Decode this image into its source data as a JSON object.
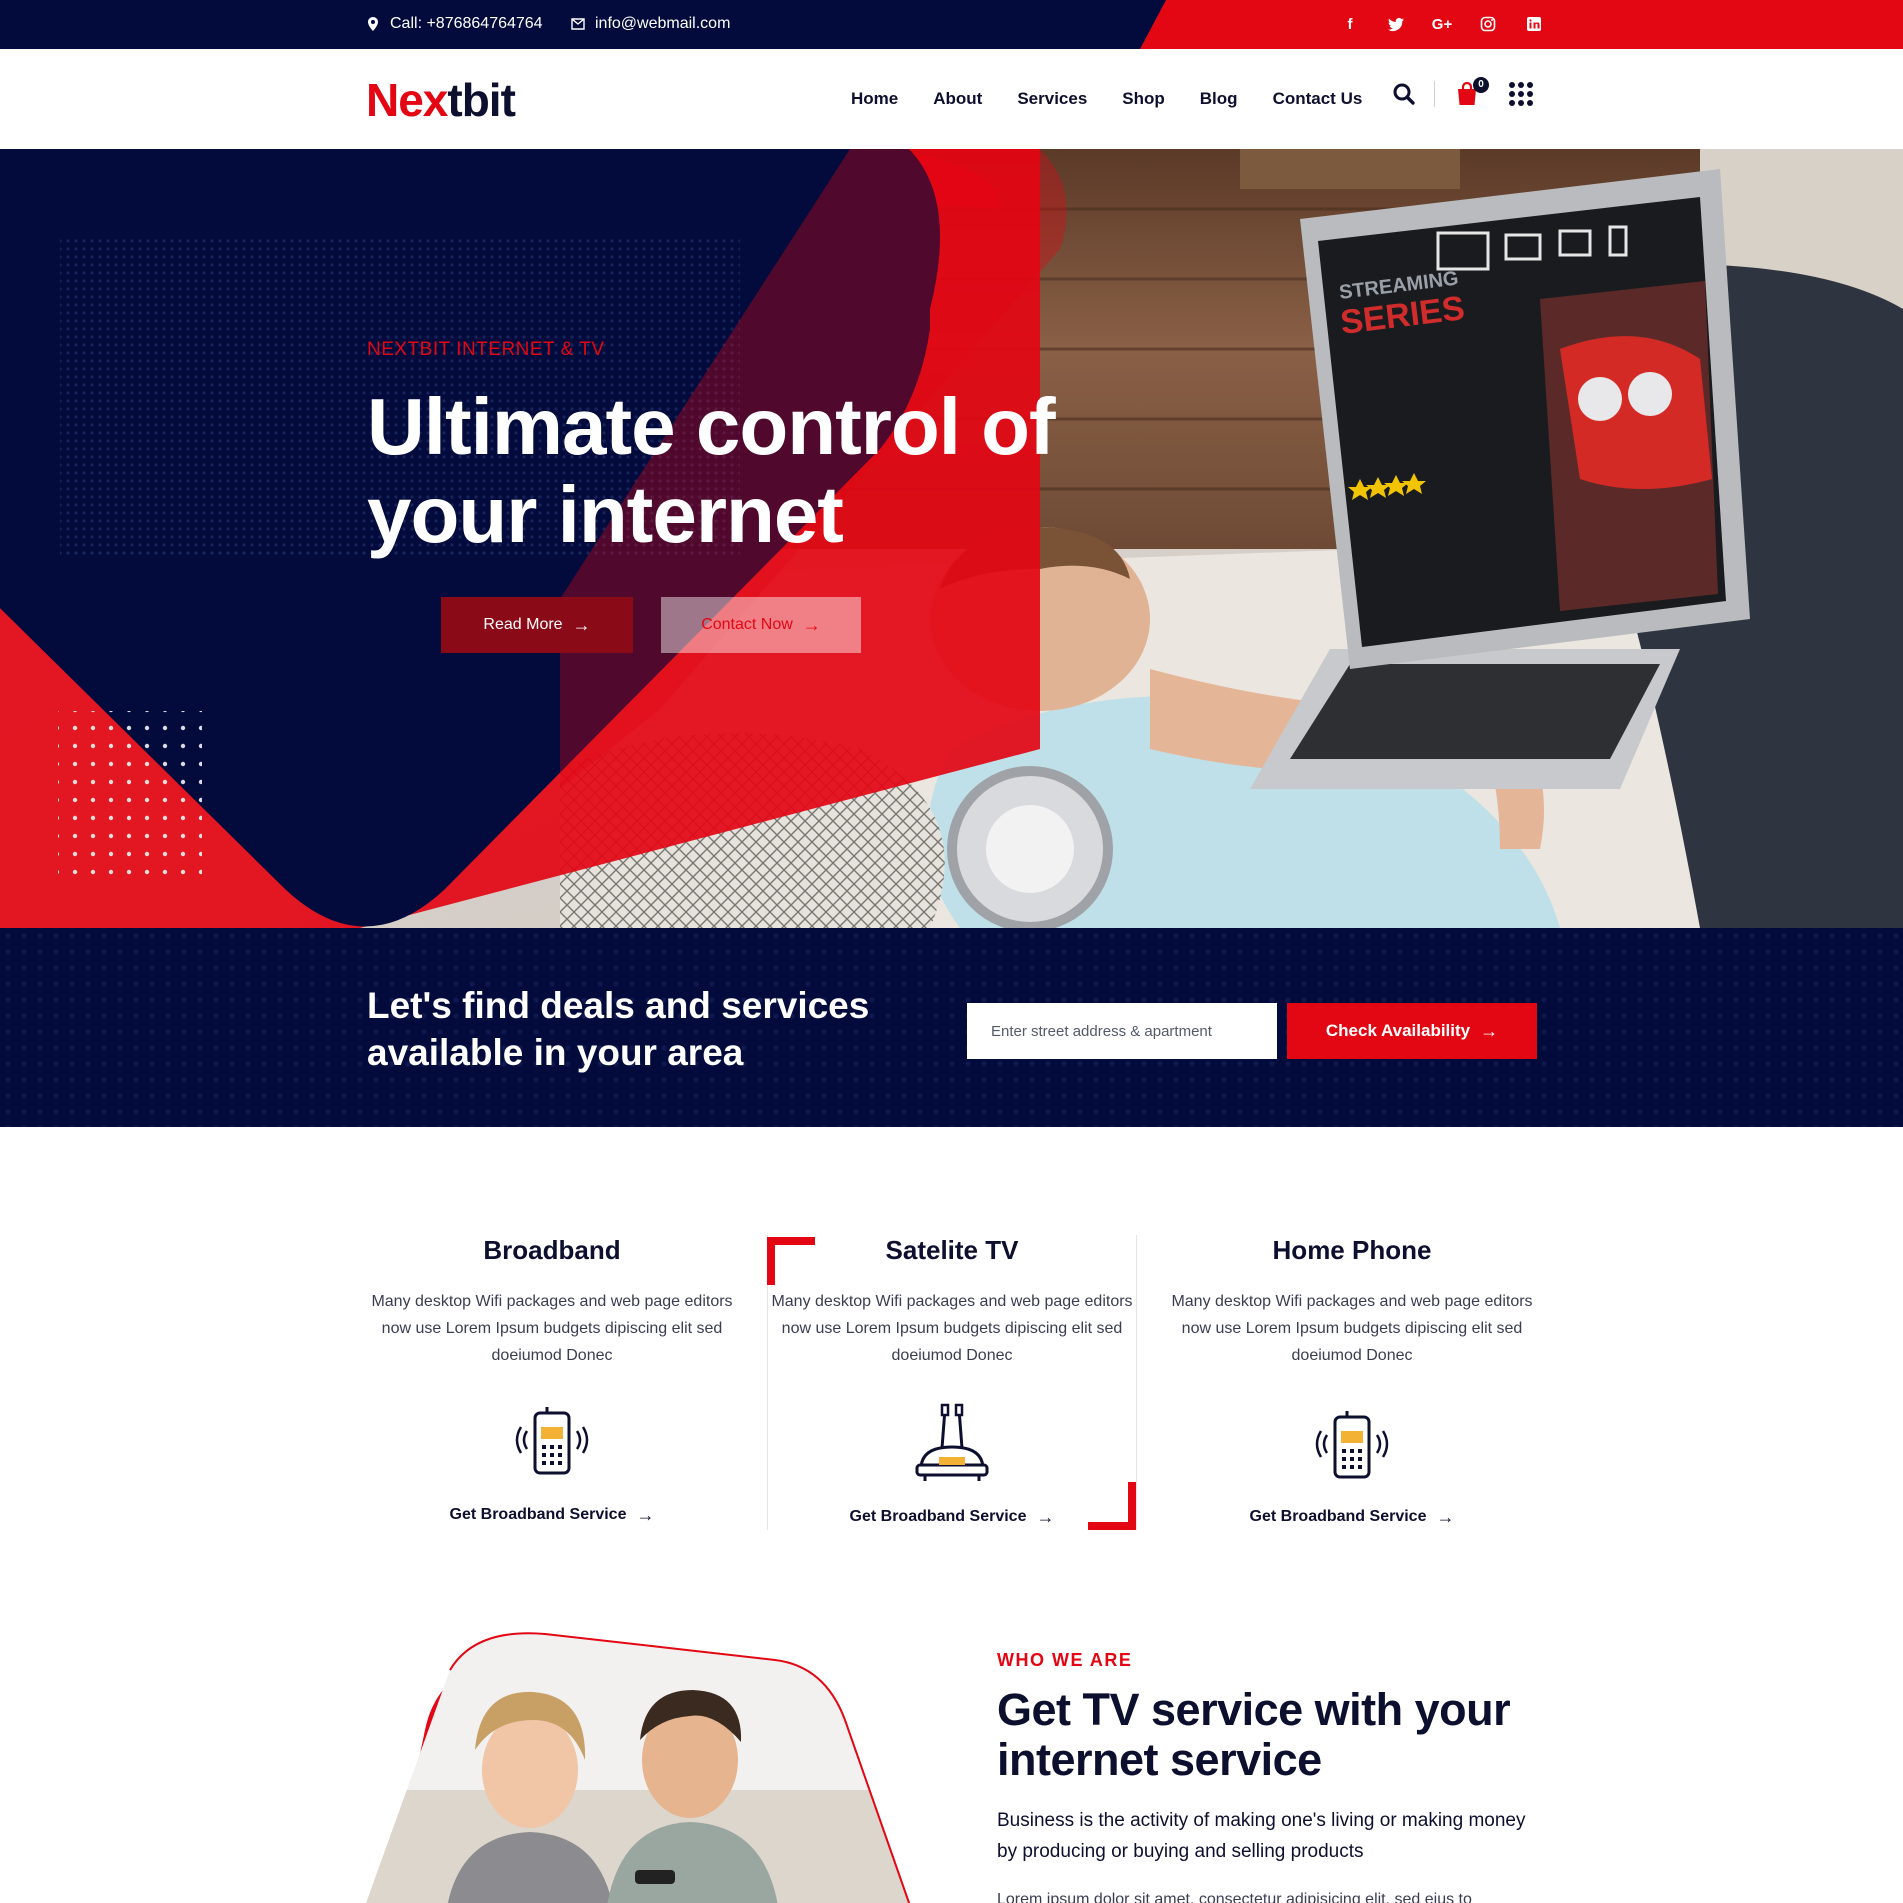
{
  "topbar": {
    "phone": "Call: +876864764764",
    "email": "info@webmail.com",
    "socials": [
      "facebook-icon",
      "twitter-icon",
      "google-plus-icon",
      "instagram-icon",
      "linkedin-icon"
    ]
  },
  "header": {
    "logo_red": "Nex",
    "logo_dark": "tbit",
    "nav": [
      "Home",
      "About",
      "Services",
      "Shop",
      "Blog",
      "Contact Us"
    ],
    "cart_count": "0"
  },
  "hero": {
    "kicker": "NEXTBIT INTERNET & TV",
    "title": "Ultimate control of your internet",
    "read_more": "Read More",
    "contact_now": "Contact Now",
    "screen_brand_top": "STREAMING",
    "screen_brand_bottom": "SERIES"
  },
  "deals": {
    "title": "Let's find deals and services available in your area",
    "placeholder": "Enter street address & apartment",
    "button": "Check Availability"
  },
  "services": [
    {
      "title": "Broadband",
      "desc": "Many desktop Wifi packages and web page editors now use Lorem Ipsum budgets dipiscing elit sed doeiumod Donec",
      "icon": "phone-icon",
      "link": "Get Broadband Service"
    },
    {
      "title": "Satelite TV",
      "desc": "Many desktop Wifi packages and web page editors now use Lorem Ipsum budgets dipiscing elit sed doeiumod Donec",
      "icon": "router-icon",
      "link": "Get Broadband Service"
    },
    {
      "title": "Home Phone",
      "desc": "Many desktop Wifi packages and web page editors now use Lorem Ipsum budgets dipiscing elit sed doeiumod Donec",
      "icon": "phone-icon",
      "link": "Get Broadband Service"
    }
  ],
  "about": {
    "kicker": "WHO WE ARE",
    "title": "Get TV service with your internet service",
    "lead": "Business is the activity of making one's living or making money by producing or buying and selling products",
    "body": "Lorem ipsum dolor sit amet, consectetur adipisicing elit, sed eius to"
  },
  "colors": {
    "brand_red": "#e30613",
    "navy": "#020b3b",
    "dark_red": "#8b0a18"
  }
}
